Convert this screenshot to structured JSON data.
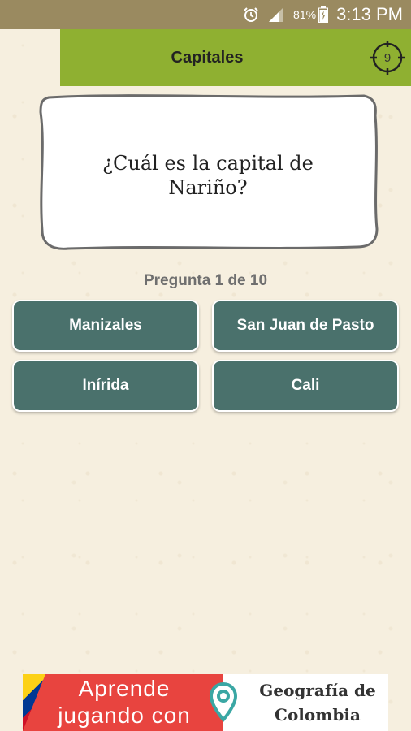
{
  "status_bar": {
    "battery_percent": "81%",
    "time": "3:13 PM"
  },
  "header": {
    "title": "Capitales",
    "timer_value": "9"
  },
  "question": {
    "text": "¿Cuál es la capital de Nariño?"
  },
  "progress": {
    "text": "Pregunta 1 de 10"
  },
  "answers": [
    {
      "label": "Manizales"
    },
    {
      "label": "San Juan de Pasto"
    },
    {
      "label": "Inírida"
    },
    {
      "label": "Cali"
    }
  ],
  "ad": {
    "left_line1": "Aprende",
    "left_line2": "jugando con",
    "right_line1": "Geografía de",
    "right_line2": "Colombia"
  },
  "colors": {
    "status_bar": "#9a8a60",
    "header": "#8fb031",
    "answer_button": "#4a716c",
    "ad_left": "#e8443f",
    "pin": "#3aa7a4"
  }
}
